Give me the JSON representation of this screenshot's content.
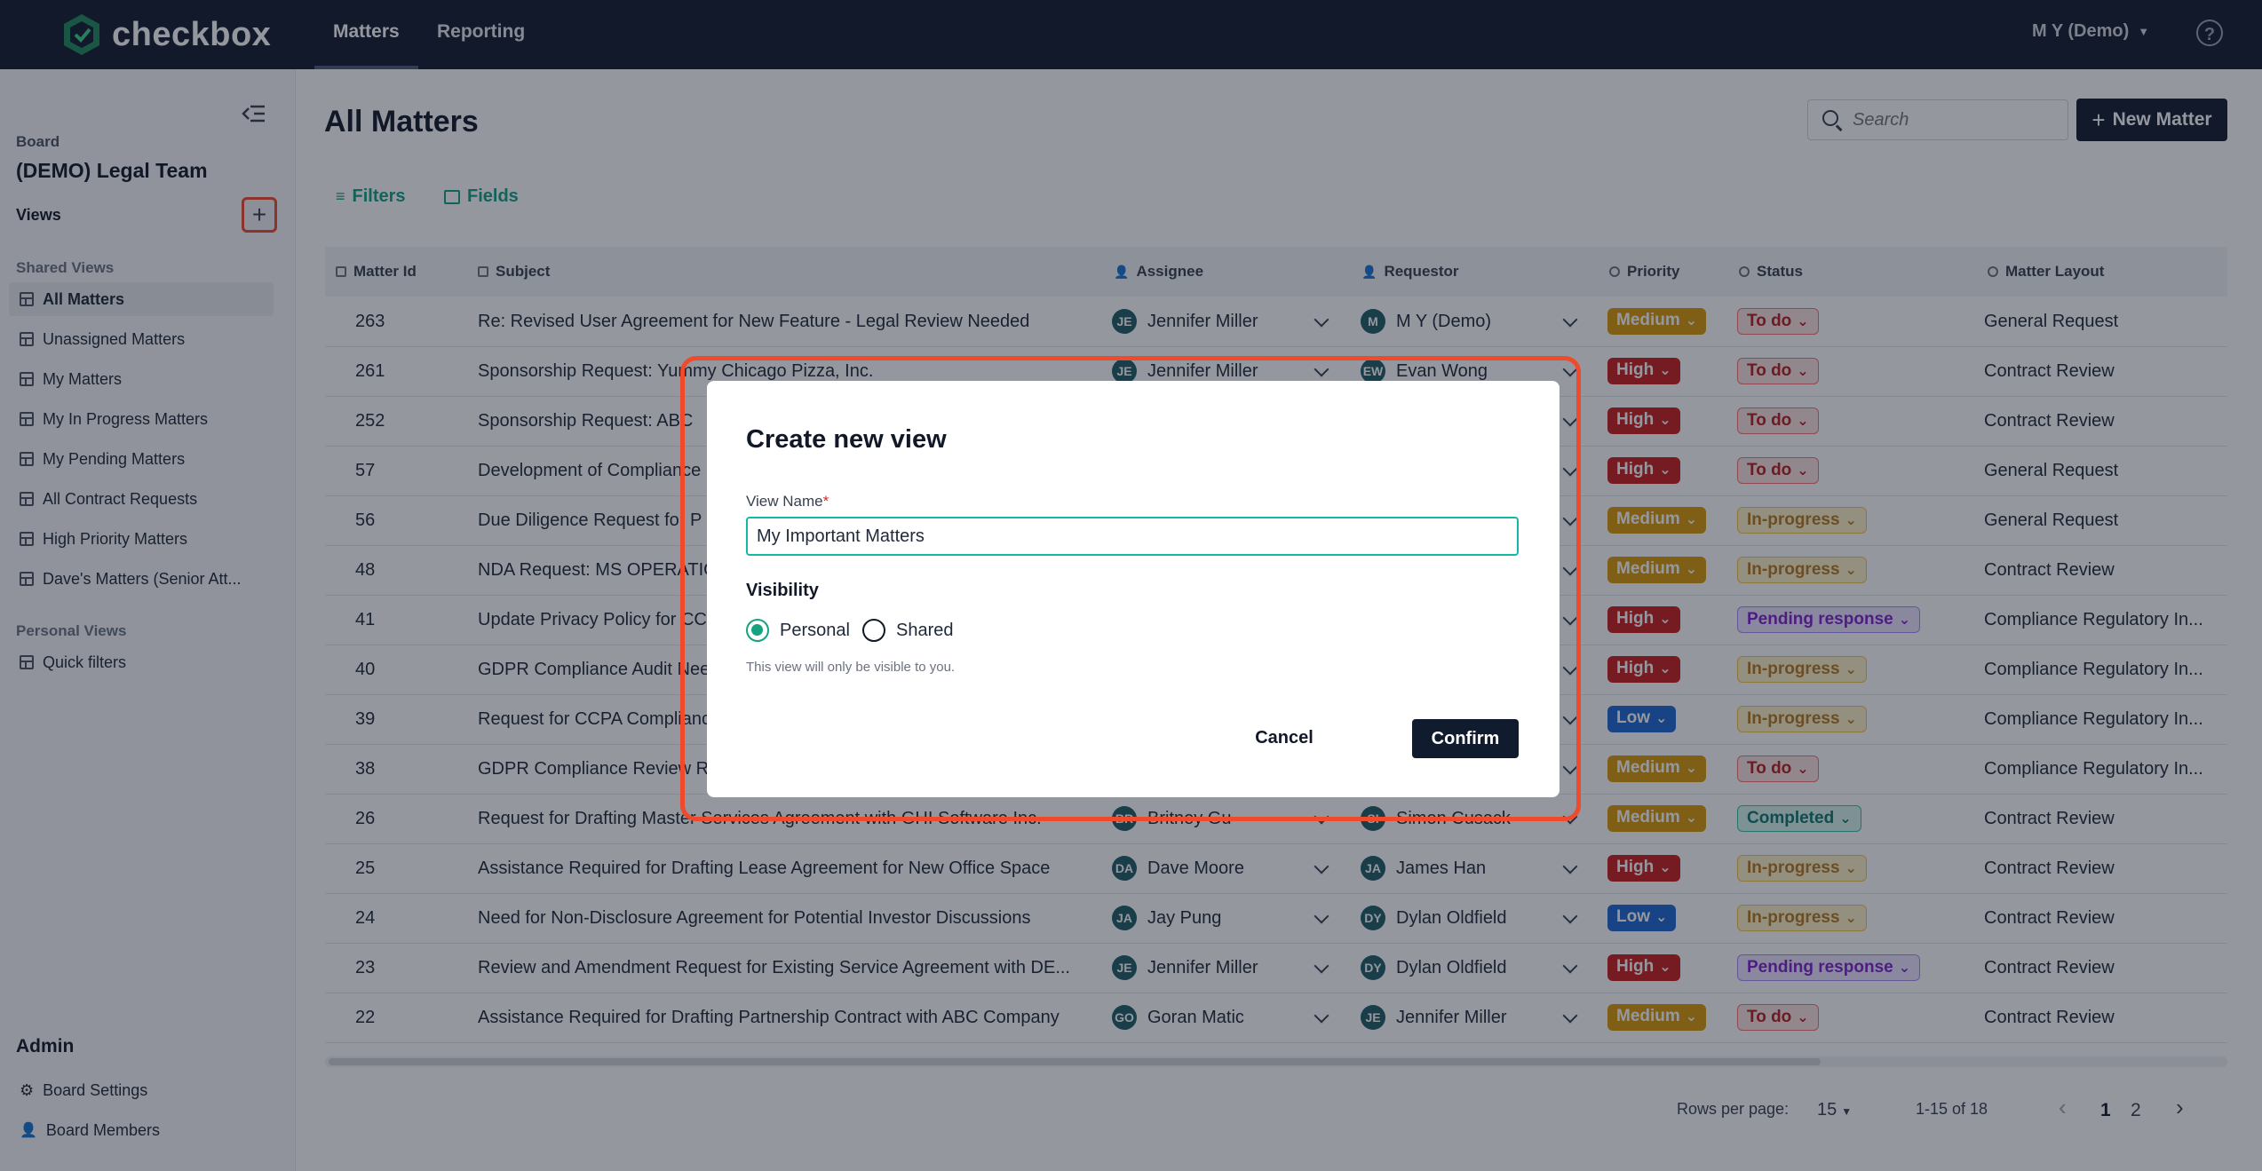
{
  "app": {
    "name": "checkbox"
  },
  "nav": {
    "tabs": [
      "Matters",
      "Reporting"
    ],
    "user": "M Y (Demo)",
    "help": "?"
  },
  "sidebar": {
    "board_label": "Board",
    "board_name": "(DEMO) Legal Team",
    "views_label": "Views",
    "add": "+",
    "shared_label": "Shared Views",
    "shared_views": [
      "All Matters",
      "Unassigned Matters",
      "My Matters",
      "My In Progress Matters",
      "My Pending Matters",
      "All Contract Requests",
      "High Priority Matters",
      "Dave's Matters (Senior Att..."
    ],
    "personal_label": "Personal Views",
    "personal_views": [
      "Quick filters"
    ],
    "admin_label": "Admin",
    "admin_items": [
      "Board Settings",
      "Board Members"
    ]
  },
  "main": {
    "title": "All Matters",
    "search_placeholder": "Search",
    "new_matter": "New Matter",
    "filters": "Filters",
    "fields": "Fields"
  },
  "table": {
    "columns": [
      "Matter Id",
      "Subject",
      "Assignee",
      "Requestor",
      "Priority",
      "Status",
      "Matter Layout"
    ],
    "rows": [
      {
        "id": "263",
        "subject": "Re: Revised User Agreement for New Feature - Legal Review Needed",
        "a_init": "JE",
        "assignee": "Jennifer Miller",
        "r_init": "M",
        "requestor": "M Y (Demo)",
        "priority": "Medium",
        "status": "To do",
        "layout": "General Request"
      },
      {
        "id": "261",
        "subject": "Sponsorship Request: Yummy Chicago Pizza, Inc.",
        "a_init": "JE",
        "assignee": "Jennifer Miller",
        "r_init": "EW",
        "requestor": "Evan Wong",
        "priority": "High",
        "status": "To do",
        "layout": "Contract Review"
      },
      {
        "id": "252",
        "subject": "Sponsorship Request: ABC",
        "a_init": "",
        "assignee": "",
        "r_init": "",
        "requestor": "",
        "priority": "High",
        "status": "To do",
        "layout": "Contract Review"
      },
      {
        "id": "57",
        "subject": "Development of Compliance",
        "a_init": "",
        "assignee": "",
        "r_init": "",
        "requestor": "",
        "priority": "High",
        "status": "To do",
        "layout": "General Request"
      },
      {
        "id": "56",
        "subject": "Due Diligence Request for P",
        "a_init": "",
        "assignee": "",
        "r_init": "",
        "requestor": "",
        "priority": "Medium",
        "status": "In-progress",
        "layout": "General Request"
      },
      {
        "id": "48",
        "subject": "NDA Request: MS OPERATIONS",
        "a_init": "",
        "assignee": "",
        "r_init": "",
        "requestor": "",
        "priority": "Medium",
        "status": "In-progress",
        "layout": "Contract Review"
      },
      {
        "id": "41",
        "subject": "Update Privacy Policy for CCPA",
        "a_init": "",
        "assignee": "",
        "r_init": "",
        "requestor": "",
        "priority": "High",
        "status": "Pending response",
        "layout": "Compliance Regulatory In..."
      },
      {
        "id": "40",
        "subject": "GDPR Compliance Audit Needed",
        "a_init": "",
        "assignee": "",
        "r_init": "",
        "requestor": "",
        "priority": "High",
        "status": "In-progress",
        "layout": "Compliance Regulatory In..."
      },
      {
        "id": "39",
        "subject": "Request for CCPA Compliance",
        "a_init": "",
        "assignee": "",
        "r_init": "",
        "requestor": "",
        "priority": "Low",
        "status": "In-progress",
        "layout": "Compliance Regulatory In..."
      },
      {
        "id": "38",
        "subject": "GDPR Compliance Review Request",
        "a_init": "",
        "assignee": "",
        "r_init": "",
        "requestor": "",
        "priority": "Medium",
        "status": "To do",
        "layout": "Compliance Regulatory In..."
      },
      {
        "id": "26",
        "subject": "Request for Drafting Master Services Agreement with GHI Software Inc.",
        "a_init": "BR",
        "assignee": "Britney Gu",
        "r_init": "SI",
        "requestor": "Simon Cusack",
        "priority": "Medium",
        "status": "Completed",
        "layout": "Contract Review"
      },
      {
        "id": "25",
        "subject": "Assistance Required for Drafting Lease Agreement for New Office Space",
        "a_init": "DA",
        "assignee": "Dave Moore",
        "r_init": "JA",
        "requestor": "James Han",
        "priority": "High",
        "status": "In-progress",
        "layout": "Contract Review"
      },
      {
        "id": "24",
        "subject": "Need for Non-Disclosure Agreement for Potential Investor Discussions",
        "a_init": "JA",
        "assignee": "Jay Pung",
        "r_init": "DY",
        "requestor": "Dylan Oldfield",
        "priority": "Low",
        "status": "In-progress",
        "layout": "Contract Review"
      },
      {
        "id": "23",
        "subject": "Review and Amendment Request for Existing Service Agreement with DE...",
        "a_init": "JE",
        "assignee": "Jennifer Miller",
        "r_init": "DY",
        "requestor": "Dylan Oldfield",
        "priority": "High",
        "status": "Pending response",
        "layout": "Contract Review"
      },
      {
        "id": "22",
        "subject": "Assistance Required for Drafting Partnership Contract with ABC Company",
        "a_init": "GO",
        "assignee": "Goran Matic",
        "r_init": "JE",
        "requestor": "Jennifer Miller",
        "priority": "Medium",
        "status": "To do",
        "layout": "Contract Review"
      }
    ]
  },
  "pagination": {
    "rows_label": "Rows per page:",
    "rows_value": "15",
    "range": "1-15 of 18",
    "pages": [
      "1",
      "2"
    ],
    "prev": "‹",
    "next": "›"
  },
  "modal": {
    "title": "Create new view",
    "name_label": "View Name",
    "required_mark": "*",
    "name_value": "My Important Matters",
    "visibility_label": "Visibility",
    "option_personal": "Personal",
    "option_shared": "Shared",
    "hint": "This view will only be visible to you.",
    "cancel": "Cancel",
    "confirm": "Confirm"
  }
}
